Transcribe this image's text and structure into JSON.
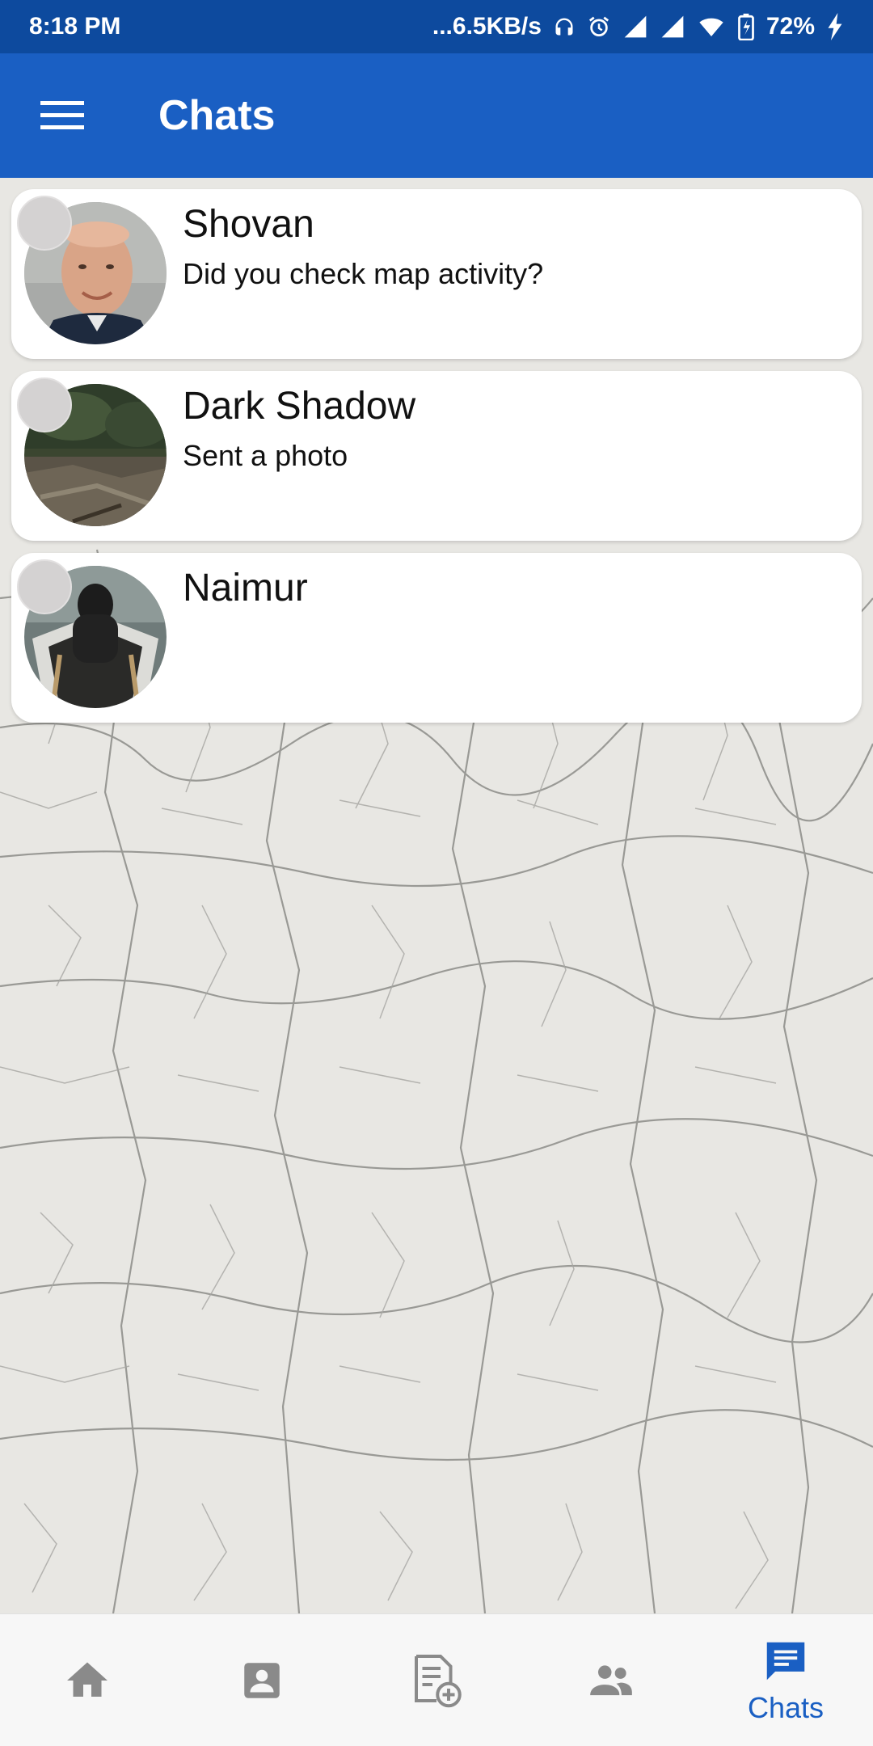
{
  "status_bar": {
    "time": "8:18 PM",
    "network_speed": "...6.5KB/s",
    "battery": "72%"
  },
  "app_bar": {
    "title": "Chats",
    "menu_icon": "hamburger-menu-icon"
  },
  "chats": [
    {
      "name": "Shovan",
      "preview": "Did you check map activity?",
      "avatar": "person-photo"
    },
    {
      "name": "Dark Shadow",
      "preview": "Sent a photo",
      "avatar": "landscape-photo"
    },
    {
      "name": "Naimur",
      "preview": "",
      "avatar": "boat-photo"
    }
  ],
  "bottom_nav": {
    "items": [
      {
        "icon": "home-icon",
        "label": ""
      },
      {
        "icon": "contact-card-icon",
        "label": ""
      },
      {
        "icon": "add-post-icon",
        "label": ""
      },
      {
        "icon": "people-icon",
        "label": ""
      },
      {
        "icon": "chat-icon",
        "label": "Chats",
        "active": true
      }
    ]
  },
  "colors": {
    "status_bar": "#0d4a9e",
    "app_bar": "#1a5fc3",
    "active_nav": "#1a5fc3",
    "inactive_nav": "#8a8a8a"
  }
}
